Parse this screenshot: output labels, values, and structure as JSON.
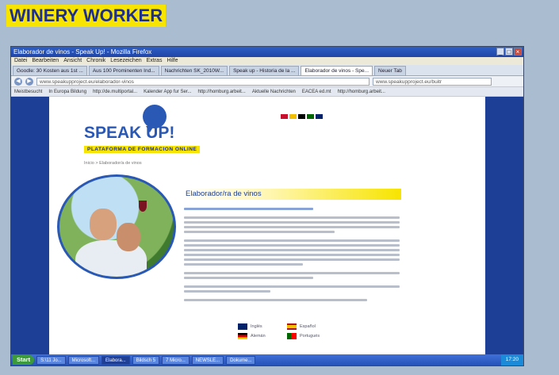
{
  "slide": {
    "title": "WINERY WORKER"
  },
  "browser": {
    "window_title": "Elaborador de vinos - Speak Up! - Mozilla Firefox",
    "menu": [
      "Datei",
      "Bearbeiten",
      "Ansicht",
      "Chronik",
      "Lesezeichen",
      "Extras",
      "Hilfe"
    ],
    "tabs": [
      "Goodle: 30 Kosten aus 1st ...",
      "Aus 100 Prominenten Ind...",
      "Nachrichten SK_2010W...",
      "Speak up - Historia de la ...",
      "Elaborador de vinos - Spe...",
      "Neuer Tab"
    ],
    "active_tab_index": 4,
    "url": "www.speakupproject.eu/elaborador-vinos",
    "search_text": "www.speakupproject.eu/buitr",
    "bookmarks": [
      "Meistbesucht",
      "In Europa Bildung",
      "http://de.multiportal...",
      "Kalender App fur Ser...",
      "http://homburg.arbeit...",
      "Aktuelle Nachrichten",
      "EACEA ed.mt",
      "http://homburg.arbeit..."
    ]
  },
  "site": {
    "logo": "SPEAK UP!",
    "tagline": "PLATAFORMA DE FORMACION ONLINE",
    "breadcrumb": "Inicio  >  Elaborador/a de vinos",
    "heading": "Elaborador/ra de vinos",
    "languages": [
      "Inglés",
      "Español",
      "Alemán",
      "Portugués"
    ]
  },
  "taskbar": {
    "start": "Start",
    "items": [
      "S:\\11 Jo...",
      "Microsoft...",
      "Elabora...",
      "Bildsch 5",
      "7 Micro...",
      "NEWSLE...",
      "Dokume..."
    ],
    "active_item_index": 2,
    "clock": "17:20"
  },
  "colors": {
    "accent_yellow": "#f7e400",
    "brand_blue": "#2a58b5",
    "rail_blue": "#1d3f96"
  }
}
